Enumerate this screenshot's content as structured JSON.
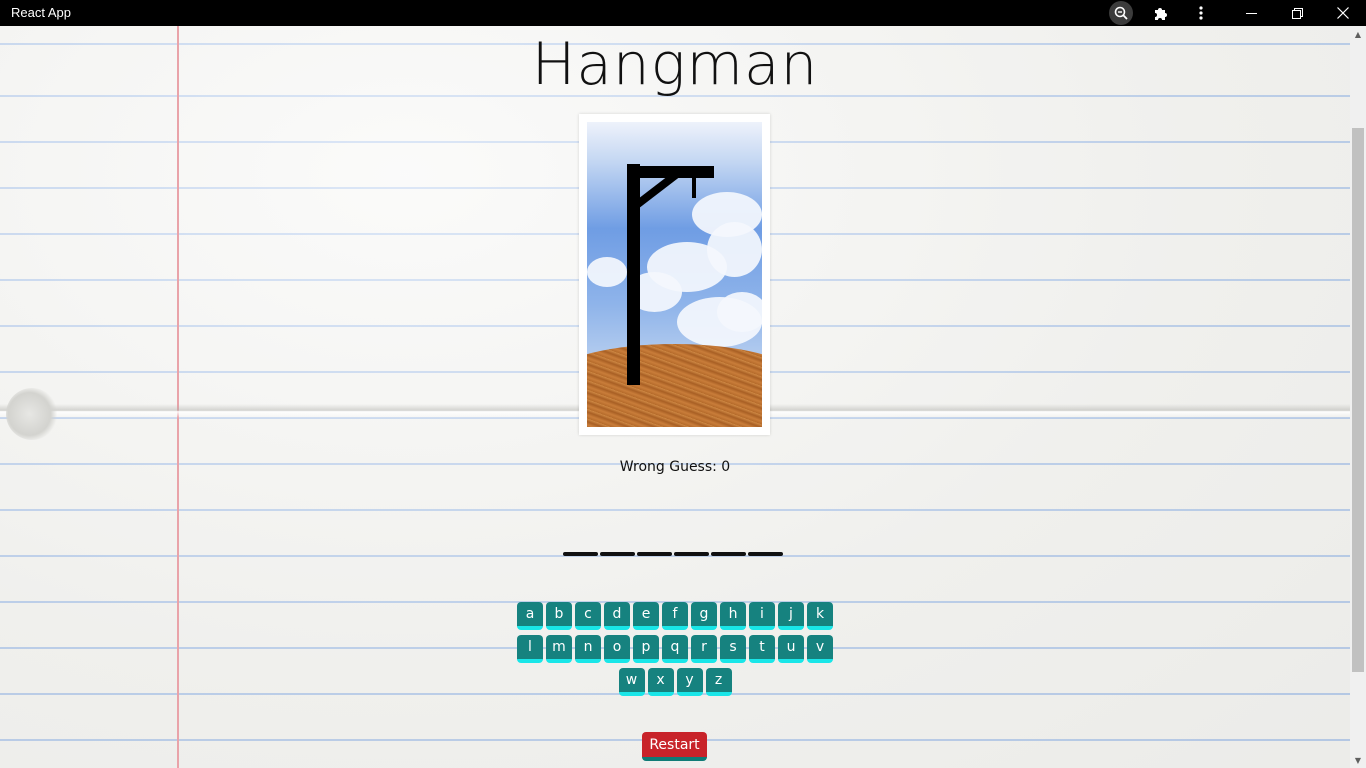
{
  "window": {
    "title": "React App",
    "controls": [
      "zoom-icon",
      "extensions-icon",
      "menu-icon",
      "minimize-icon",
      "restore-icon",
      "close-icon"
    ]
  },
  "game": {
    "title": "Hangman",
    "wrong_guess_label": "Wrong Guess: 0",
    "word_length": 6,
    "hangman_image": "gallows-empty",
    "keyboard": {
      "rows": [
        [
          "a",
          "b",
          "c",
          "d",
          "e",
          "f",
          "g",
          "h",
          "i",
          "j",
          "k"
        ],
        [
          "l",
          "m",
          "n",
          "o",
          "p",
          "q",
          "r",
          "s",
          "t",
          "u",
          "v"
        ],
        [
          "w",
          "x",
          "y",
          "z"
        ]
      ]
    },
    "restart_label": "Restart"
  },
  "colors": {
    "key_bg": "#16827f",
    "key_shadow": "#19e6e8",
    "restart_bg": "#c8232a",
    "paper_line": "#a9c3ea",
    "margin_line": "#e9a3a9"
  }
}
